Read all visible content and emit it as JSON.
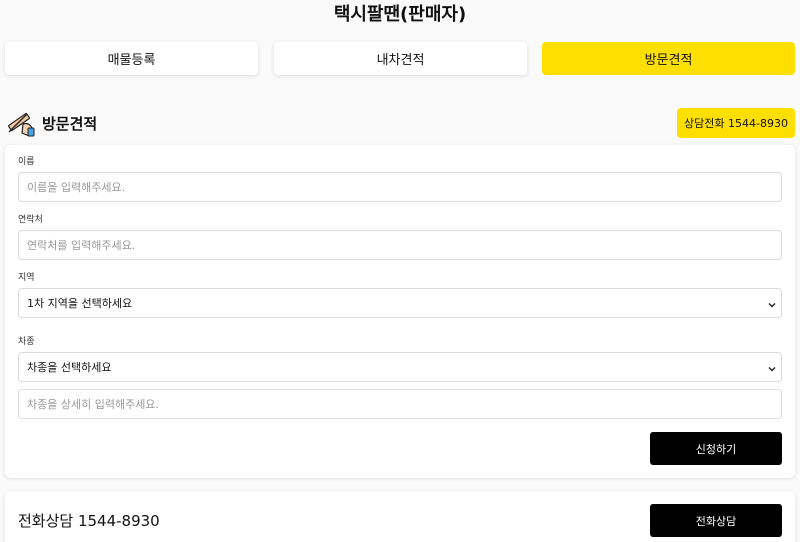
{
  "header": {
    "title": "택시팔땐(판매자)"
  },
  "tabs": [
    {
      "label": "매물등록",
      "active": false
    },
    {
      "label": "내차견적",
      "active": false
    },
    {
      "label": "방문견적",
      "active": true
    }
  ],
  "section": {
    "icon": "writing-hand-icon",
    "title": "방문견적",
    "call_badge": "상담전화 1544-8930"
  },
  "form": {
    "name": {
      "label": "이름",
      "placeholder": "이름을 입력해주세요."
    },
    "contact": {
      "label": "연락처",
      "placeholder": "연락처를 입력해주세요."
    },
    "region": {
      "label": "지역",
      "selected": "1차 지역을 선택하세요"
    },
    "car_type": {
      "label": "차종",
      "selected": "차종을 선택하세요",
      "detail_placeholder": "차종을 상세히 입력해주세요."
    },
    "submit_label": "신청하기"
  },
  "bottom": {
    "title": "전화상담 1544-8930",
    "button_label": "전화상담"
  },
  "colors": {
    "accent": "#ffdf00",
    "button": "#000000",
    "background": "#fafafa"
  }
}
